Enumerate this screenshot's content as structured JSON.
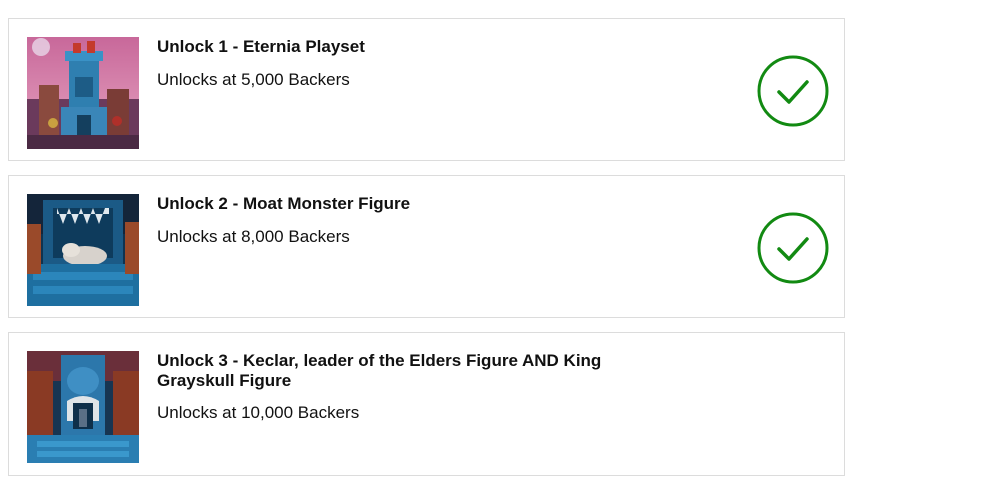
{
  "unlocks": [
    {
      "title": "Unlock 1 - Eternia Playset",
      "subtitle": "Unlocks at 5,000 Backers",
      "unlocked": true,
      "image_icon": "eternia-playset-image"
    },
    {
      "title": "Unlock 2 - Moat Monster Figure",
      "subtitle": "Unlocks at 8,000 Backers",
      "unlocked": true,
      "image_icon": "moat-monster-image"
    },
    {
      "title": "Unlock 3 - Keclar, leader of the Elders Figure AND King Grayskull Figure",
      "subtitle": "Unlocks at 10,000 Backers",
      "unlocked": false,
      "image_icon": "keclar-grayskull-image"
    }
  ],
  "colors": {
    "check_green": "#128a12",
    "card_border": "#dcdcdc"
  },
  "icons": {
    "unlocked_badge": "checkmark-circle-icon"
  }
}
